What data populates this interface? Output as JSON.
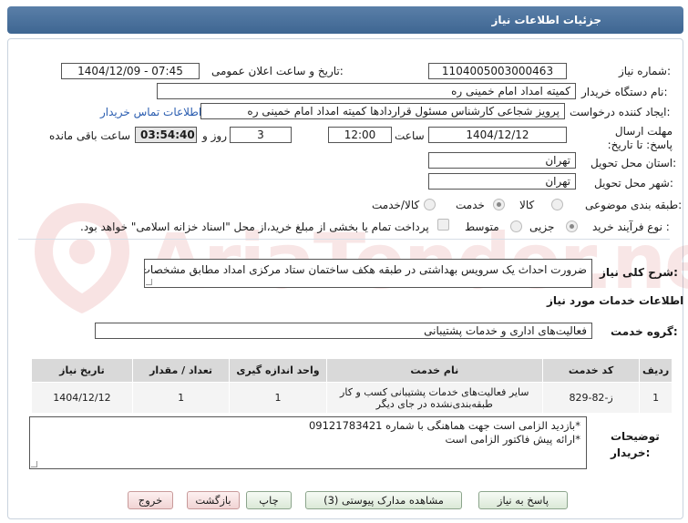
{
  "header": {
    "title": "جزئیات اطلاعات نیاز"
  },
  "fields": {
    "need_number_label": "شماره نیاز:",
    "need_number": "1104005003000463",
    "announce_label": "تاریخ و ساعت اعلان عمومی:",
    "announce_value": "1404/12/09 - 07:45",
    "buyer_org_label": "نام دستگاه خریدار:",
    "buyer_org": "کمیته امداد امام خمینی ره",
    "creator_label": "ایجاد کننده درخواست:",
    "creator": "پرویز شجاعی کارشناس مسئول قراردادها کمیته امداد امام خمینی ره",
    "contact_link": "اطلاعات تماس خریدار",
    "deadline_label": "مهلت ارسال پاسخ: تا تاریخ:",
    "deadline_date": "1404/12/12",
    "time_label": "ساعت",
    "deadline_time": "12:00",
    "days_value": "3",
    "days_label": "روز و",
    "remaining_time": "03:54:40",
    "remaining_label": "ساعت باقی مانده",
    "province_label": "استان محل تحویل:",
    "province": "تهران",
    "city_label": "شهر محل تحویل:",
    "city": "تهران",
    "category_label": "طبقه بندی موضوعی:",
    "category_options": [
      "کالا",
      "خدمت",
      "کالا/خدمت"
    ],
    "category_selected": "خدمت",
    "process_label": "نوع فرآیند خرید :",
    "process_options": [
      "جزیی",
      "متوسط"
    ],
    "process_selected": "جزیی",
    "treasury_note": "پرداخت تمام یا بخشی از مبلغ خرید،از محل \"اسناد خزانه اسلامی\" خواهد بود."
  },
  "description": {
    "label": "شرح کلی نیاز:",
    "value": "ضرورت احداث یک سرویس بهداشتی در طبقه هکف ساختمان ستاد مرکزی امداد مطابق مشخصات پیوست"
  },
  "services": {
    "section_title": "اطلاعات خدمات مورد نیاز",
    "group_label": "گروه خدمت:",
    "group_value": "فعالیت‌های اداری و خدمات پشتیبانی"
  },
  "table": {
    "headers": [
      "ردیف",
      "کد خدمت",
      "نام خدمت",
      "واحد اندازه گیری",
      "تعداد / مقدار",
      "تاریخ نیاز"
    ],
    "rows": [
      {
        "row": "1",
        "code": "ز-82-829",
        "name_line1": "سایر فعالیت‌های خدمات پشتیبانی کسب و کار",
        "name_line2": "طبقه‌بندی‌نشده در جای دیگر",
        "unit": "1",
        "qty": "1",
        "date": "1404/12/12"
      }
    ]
  },
  "buyer_notes": {
    "label_line1": "توضیحات",
    "label_line2": "خریدار:",
    "line1": "*بازدید الزامی است جهت هماهنگی با شماره 09121783421",
    "line2": "*ارائه پیش فاکتور الزامی است"
  },
  "buttons": {
    "respond": "پاسخ به نیاز",
    "attachments": "مشاهده مدارک پیوستی (3)",
    "print": "چاپ",
    "back": "بازگشت",
    "exit": "خروج"
  },
  "watermark": {
    "text": "AriaTender.net"
  }
}
